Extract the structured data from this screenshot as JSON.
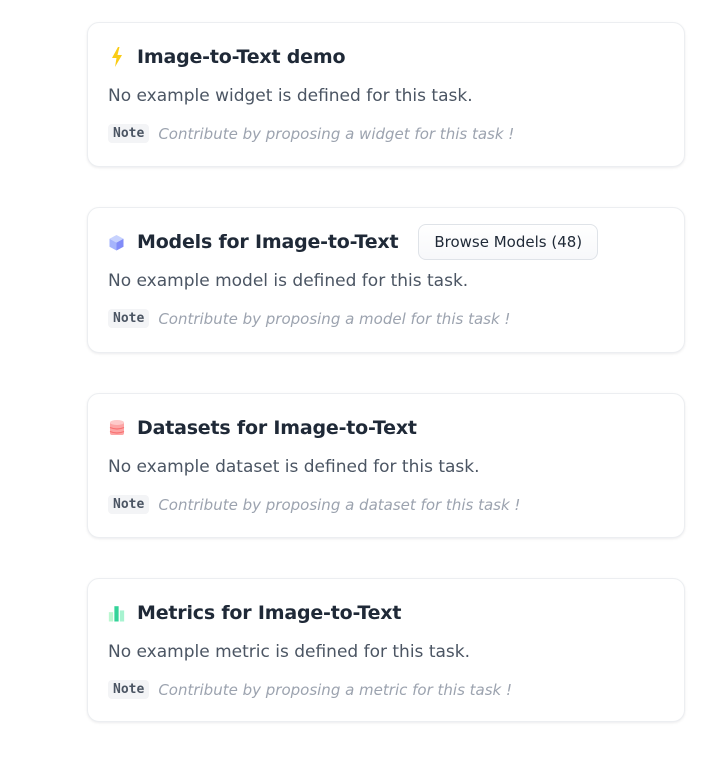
{
  "sections": [
    {
      "icon": "lightning-icon",
      "title": "Image-to-Text demo",
      "description": "No example widget is defined for this task.",
      "note_tag": "Note",
      "note_text": "Contribute by proposing a widget for this task !"
    },
    {
      "icon": "cube-icon",
      "title": "Models for Image-to-Text",
      "button_label": "Browse Models (48)",
      "description": "No example model is defined for this task.",
      "note_tag": "Note",
      "note_text": "Contribute by proposing a model for this task !"
    },
    {
      "icon": "database-icon",
      "title": "Datasets for Image-to-Text",
      "description": "No example dataset is defined for this task.",
      "note_tag": "Note",
      "note_text": "Contribute by proposing a dataset for this task !"
    },
    {
      "icon": "bar-chart-icon",
      "title": "Metrics for Image-to-Text",
      "description": "No example metric is defined for this task.",
      "note_tag": "Note",
      "note_text": "Contribute by proposing a metric for this task !"
    }
  ],
  "colors": {
    "lightning": "#facc15",
    "cube": "#818cf8",
    "database": "#f87171",
    "chart": "#34d399"
  }
}
